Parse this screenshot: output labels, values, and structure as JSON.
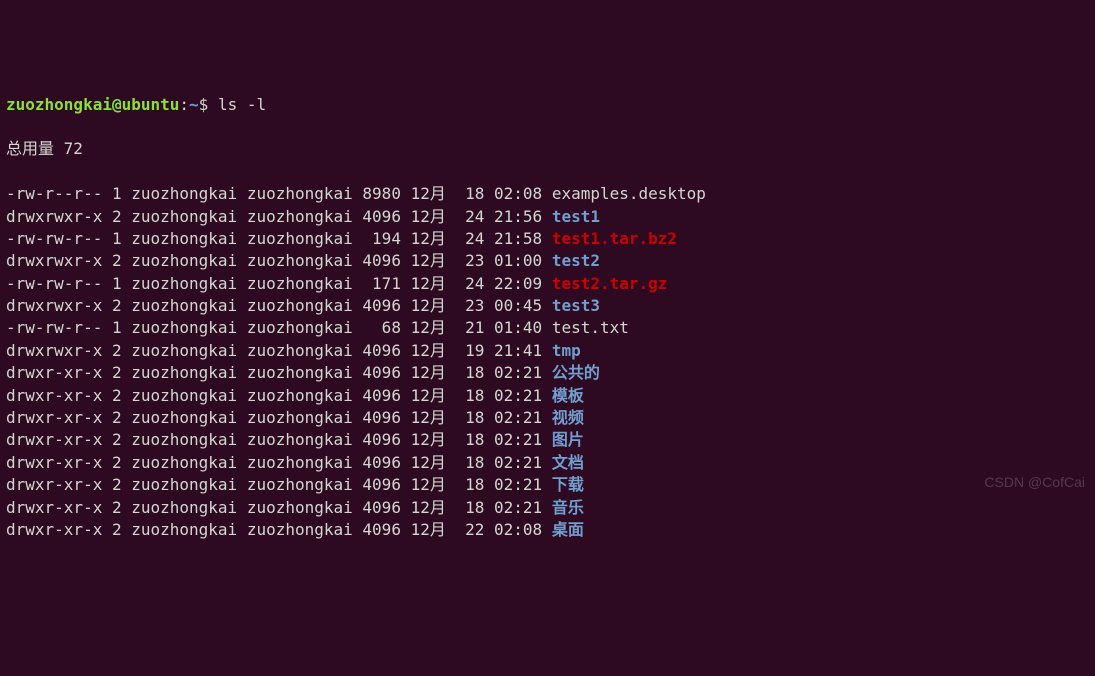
{
  "prompt": {
    "user_host": "zuozhongkai@ubuntu",
    "separator": ":",
    "path": "~",
    "symbol": "$",
    "command": " ls -l"
  },
  "total_line": "总用量 72",
  "rows": [
    {
      "perm": "-rw-r--r--",
      "links": "1",
      "owner": "zuozhongkai",
      "group": "zuozhongkai",
      "size": "8980",
      "month": "12月",
      "day": "18",
      "time": "02:08",
      "name": "examples.desktop",
      "cls": "file-reg"
    },
    {
      "perm": "drwxrwxr-x",
      "links": "2",
      "owner": "zuozhongkai",
      "group": "zuozhongkai",
      "size": "4096",
      "month": "12月",
      "day": "24",
      "time": "21:56",
      "name": "test1",
      "cls": "file-dir"
    },
    {
      "perm": "-rw-rw-r--",
      "links": "1",
      "owner": "zuozhongkai",
      "group": "zuozhongkai",
      "size": "194",
      "month": "12月",
      "day": "24",
      "time": "21:58",
      "name": "test1.tar.bz2",
      "cls": "file-arc"
    },
    {
      "perm": "drwxrwxr-x",
      "links": "2",
      "owner": "zuozhongkai",
      "group": "zuozhongkai",
      "size": "4096",
      "month": "12月",
      "day": "23",
      "time": "01:00",
      "name": "test2",
      "cls": "file-dir"
    },
    {
      "perm": "-rw-rw-r--",
      "links": "1",
      "owner": "zuozhongkai",
      "group": "zuozhongkai",
      "size": "171",
      "month": "12月",
      "day": "24",
      "time": "22:09",
      "name": "test2.tar.gz",
      "cls": "file-arc"
    },
    {
      "perm": "drwxrwxr-x",
      "links": "2",
      "owner": "zuozhongkai",
      "group": "zuozhongkai",
      "size": "4096",
      "month": "12月",
      "day": "23",
      "time": "00:45",
      "name": "test3",
      "cls": "file-dir"
    },
    {
      "perm": "-rw-rw-r--",
      "links": "1",
      "owner": "zuozhongkai",
      "group": "zuozhongkai",
      "size": "68",
      "month": "12月",
      "day": "21",
      "time": "01:40",
      "name": "test.txt",
      "cls": "file-reg"
    },
    {
      "perm": "drwxrwxr-x",
      "links": "2",
      "owner": "zuozhongkai",
      "group": "zuozhongkai",
      "size": "4096",
      "month": "12月",
      "day": "19",
      "time": "21:41",
      "name": "tmp",
      "cls": "file-dir"
    },
    {
      "perm": "drwxr-xr-x",
      "links": "2",
      "owner": "zuozhongkai",
      "group": "zuozhongkai",
      "size": "4096",
      "month": "12月",
      "day": "18",
      "time": "02:21",
      "name": "公共的",
      "cls": "file-dir"
    },
    {
      "perm": "drwxr-xr-x",
      "links": "2",
      "owner": "zuozhongkai",
      "group": "zuozhongkai",
      "size": "4096",
      "month": "12月",
      "day": "18",
      "time": "02:21",
      "name": "模板",
      "cls": "file-dir"
    },
    {
      "perm": "drwxr-xr-x",
      "links": "2",
      "owner": "zuozhongkai",
      "group": "zuozhongkai",
      "size": "4096",
      "month": "12月",
      "day": "18",
      "time": "02:21",
      "name": "视频",
      "cls": "file-dir"
    },
    {
      "perm": "drwxr-xr-x",
      "links": "2",
      "owner": "zuozhongkai",
      "group": "zuozhongkai",
      "size": "4096",
      "month": "12月",
      "day": "18",
      "time": "02:21",
      "name": "图片",
      "cls": "file-dir"
    },
    {
      "perm": "drwxr-xr-x",
      "links": "2",
      "owner": "zuozhongkai",
      "group": "zuozhongkai",
      "size": "4096",
      "month": "12月",
      "day": "18",
      "time": "02:21",
      "name": "文档",
      "cls": "file-dir"
    },
    {
      "perm": "drwxr-xr-x",
      "links": "2",
      "owner": "zuozhongkai",
      "group": "zuozhongkai",
      "size": "4096",
      "month": "12月",
      "day": "18",
      "time": "02:21",
      "name": "下载",
      "cls": "file-dir"
    },
    {
      "perm": "drwxr-xr-x",
      "links": "2",
      "owner": "zuozhongkai",
      "group": "zuozhongkai",
      "size": "4096",
      "month": "12月",
      "day": "18",
      "time": "02:21",
      "name": "音乐",
      "cls": "file-dir"
    },
    {
      "perm": "drwxr-xr-x",
      "links": "2",
      "owner": "zuozhongkai",
      "group": "zuozhongkai",
      "size": "4096",
      "month": "12月",
      "day": "22",
      "time": "02:08",
      "name": "桌面",
      "cls": "file-dir"
    }
  ],
  "watermark": "CSDN @CofCai"
}
